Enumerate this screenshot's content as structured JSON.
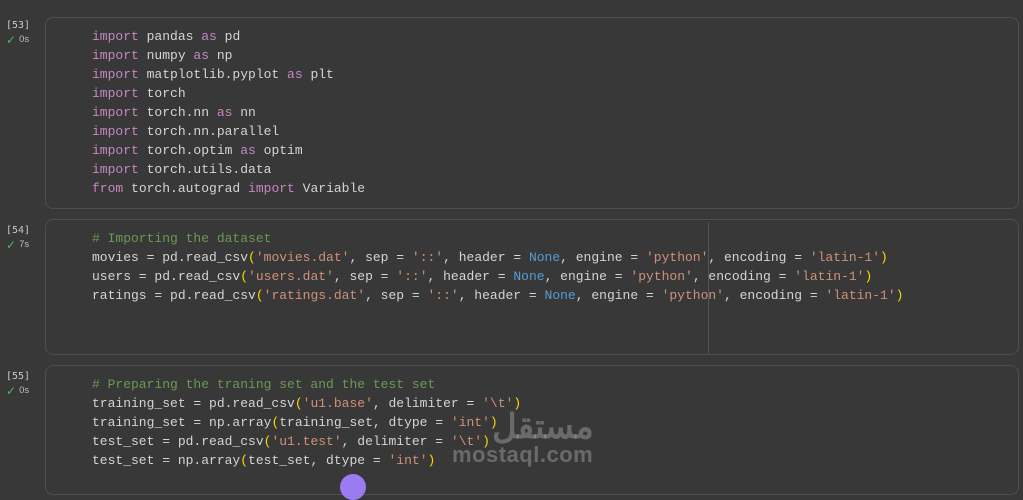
{
  "cells": [
    {
      "exec_count": "[53]",
      "status_time": "0s",
      "lines": [
        [
          [
            "kw",
            "import"
          ],
          [
            "t",
            " pandas "
          ],
          [
            "kw",
            "as"
          ],
          [
            "t",
            " pd"
          ]
        ],
        [
          [
            "kw",
            "import"
          ],
          [
            "t",
            " numpy "
          ],
          [
            "kw",
            "as"
          ],
          [
            "t",
            " np"
          ]
        ],
        [
          [
            "kw",
            "import"
          ],
          [
            "t",
            " matplotlib.pyplot "
          ],
          [
            "kw",
            "as"
          ],
          [
            "t",
            " plt"
          ]
        ],
        [
          [
            "kw",
            "import"
          ],
          [
            "t",
            " torch"
          ]
        ],
        [
          [
            "kw",
            "import"
          ],
          [
            "t",
            " torch.nn "
          ],
          [
            "kw",
            "as"
          ],
          [
            "t",
            " nn"
          ]
        ],
        [
          [
            "kw",
            "import"
          ],
          [
            "t",
            " torch.nn.parallel"
          ]
        ],
        [
          [
            "kw",
            "import"
          ],
          [
            "t",
            " torch.optim "
          ],
          [
            "kw",
            "as"
          ],
          [
            "t",
            " optim"
          ]
        ],
        [
          [
            "kw",
            "import"
          ],
          [
            "t",
            " torch.utils.data"
          ]
        ],
        [
          [
            "kw",
            "from"
          ],
          [
            "t",
            " torch.autograd "
          ],
          [
            "kw",
            "import"
          ],
          [
            "t",
            " Variable"
          ]
        ]
      ]
    },
    {
      "exec_count": "[54]",
      "status_time": "7s",
      "lines": [
        [
          [
            "com",
            "# Importing the dataset"
          ]
        ],
        [
          [
            "t",
            "movies = pd.read_csv"
          ],
          [
            "br",
            "("
          ],
          [
            "str",
            "'movies.dat'"
          ],
          [
            "t",
            ", sep = "
          ],
          [
            "str",
            "'::'"
          ],
          [
            "t",
            ", header = "
          ],
          [
            "const",
            "None"
          ],
          [
            "t",
            ", engine = "
          ],
          [
            "str",
            "'python'"
          ],
          [
            "t",
            ", encoding = "
          ],
          [
            "str",
            "'latin-1'"
          ],
          [
            "br",
            ")"
          ]
        ],
        [
          [
            "t",
            "users = pd.read_csv"
          ],
          [
            "br",
            "("
          ],
          [
            "str",
            "'users.dat'"
          ],
          [
            "t",
            ", sep = "
          ],
          [
            "str",
            "'::'"
          ],
          [
            "t",
            ", header = "
          ],
          [
            "const",
            "None"
          ],
          [
            "t",
            ", engine = "
          ],
          [
            "str",
            "'python'"
          ],
          [
            "t",
            ", encoding = "
          ],
          [
            "str",
            "'latin-1'"
          ],
          [
            "br",
            ")"
          ]
        ],
        [
          [
            "t",
            "ratings = pd.read_csv"
          ],
          [
            "br",
            "("
          ],
          [
            "str",
            "'ratings.dat'"
          ],
          [
            "t",
            ", sep = "
          ],
          [
            "str",
            "'::'"
          ],
          [
            "t",
            ", header = "
          ],
          [
            "const",
            "None"
          ],
          [
            "t",
            ", engine = "
          ],
          [
            "str",
            "'python'"
          ],
          [
            "t",
            ", encoding = "
          ],
          [
            "str",
            "'latin-1'"
          ],
          [
            "br",
            ")"
          ]
        ]
      ]
    },
    {
      "exec_count": "[55]",
      "status_time": "0s",
      "lines": [
        [
          [
            "com",
            "# Preparing the traning set and the test set"
          ]
        ],
        [
          [
            "t",
            "training_set = pd.read_csv"
          ],
          [
            "br",
            "("
          ],
          [
            "str",
            "'u1.base'"
          ],
          [
            "t",
            ", delimiter = "
          ],
          [
            "str",
            "'\\t'"
          ],
          [
            "br",
            ")"
          ]
        ],
        [
          [
            "t",
            "training_set = np.array"
          ],
          [
            "br",
            "("
          ],
          [
            "t",
            "training_set, dtype = "
          ],
          [
            "str",
            "'int'"
          ],
          [
            "br",
            ")"
          ]
        ],
        [
          [
            "t",
            "test_set = pd.read_csv"
          ],
          [
            "br",
            "("
          ],
          [
            "str",
            "'u1.test'"
          ],
          [
            "t",
            ", delimiter = "
          ],
          [
            "str",
            "'\\t'"
          ],
          [
            "br",
            ")"
          ]
        ],
        [
          [
            "t",
            "test_set = np.array"
          ],
          [
            "br",
            "("
          ],
          [
            "t",
            "test_set, dtype = "
          ],
          [
            "str",
            "'int'"
          ],
          [
            "br",
            ")"
          ]
        ]
      ]
    }
  ],
  "watermark": {
    "arabic": "مستقل",
    "latin": "mostaql.com"
  }
}
